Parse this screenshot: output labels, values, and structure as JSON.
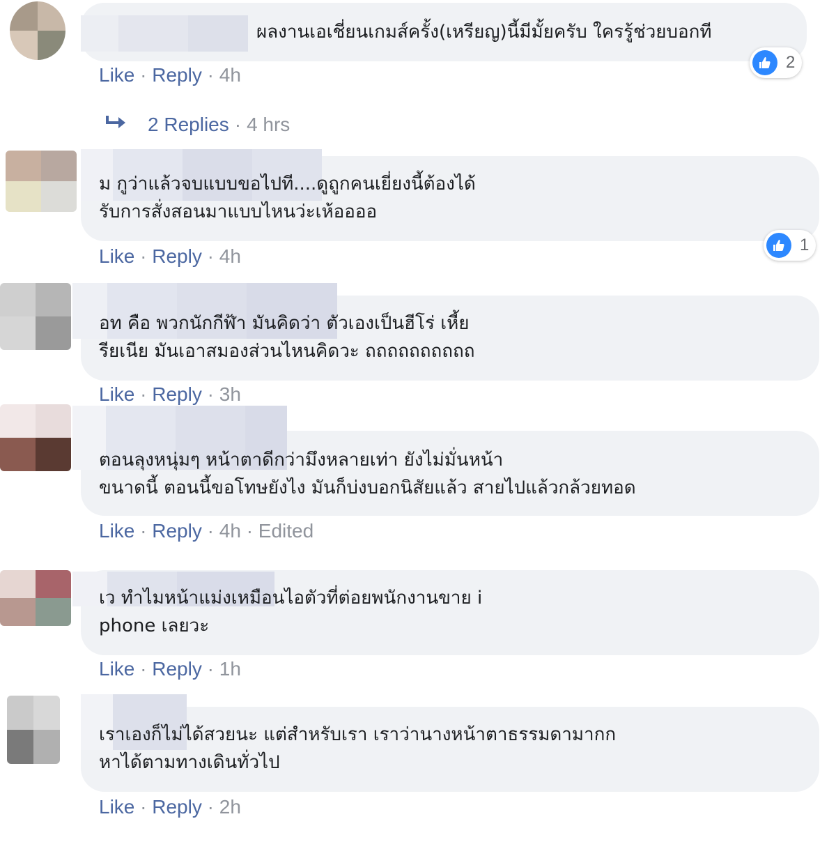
{
  "comments": [
    {
      "text": "ผลงานเอเชี่ยนเกมส์ครั้ง(เหรียญ)นี้มีมั้ยครับ ใครรู้ช่วยบอกที",
      "like": "Like",
      "reply": "Reply",
      "time": "4h",
      "reactions": "2"
    },
    {
      "text": "ม กูว่าแล้วจบแบบขอไปที....ดูถูกคนเยี่ยงนี้ต้องได้\nรับการสั่งสอนมาแบบไหนว่ะเห้ออออ",
      "like": "Like",
      "reply": "Reply",
      "time": "4h",
      "reactions": "1"
    },
    {
      "text": "อท คือ พวกนักกีฬ้า มันคิดว่า ตัวเองเป็นฮีโร่ เหี้ย\nรียเนีย มันเอาสมองส่วนไหนคิดวะ ถถถถถถถถถถ",
      "like": "Like",
      "reply": "Reply",
      "time": "3h"
    },
    {
      "text": "ตอนลุงหนุ่มๆ หน้าตาดีกว่ามึงหลายเท่า ยังไม่มั่นหน้า\nขนาดนี้ ตอนนี้ขอโทษยังไง มันก็บ่งบอกนิสัยแล้ว สายไปแล้วกล้วยทอด",
      "like": "Like",
      "reply": "Reply",
      "time": "4h",
      "edited": "Edited"
    },
    {
      "text": "เว ทำไมหน้าแม่งเหมือนไอตัวที่ต่อยพนักงานขาย i\nphone เลยวะ",
      "like": "Like",
      "reply": "Reply",
      "time": "1h"
    },
    {
      "text": "เราเองก็ไม่ได้สวยนะ แต่สำหรับเรา เราว่านางหน้าตาธรรมดามากก\nหาได้ตามทางเดินทั่วไป",
      "like": "Like",
      "reply": "Reply",
      "time": "2h"
    }
  ],
  "replies": {
    "label": "2 Replies",
    "time": "4 hrs"
  },
  "separator": "·",
  "colors": {
    "link": "#4b67a1",
    "muted": "#90949c",
    "bubble": "#f0f2f5",
    "like_blue": "#2d88ff"
  },
  "icons": {
    "like": "thumbs-up-icon",
    "reply_arrow": "reply-arrow-icon"
  }
}
